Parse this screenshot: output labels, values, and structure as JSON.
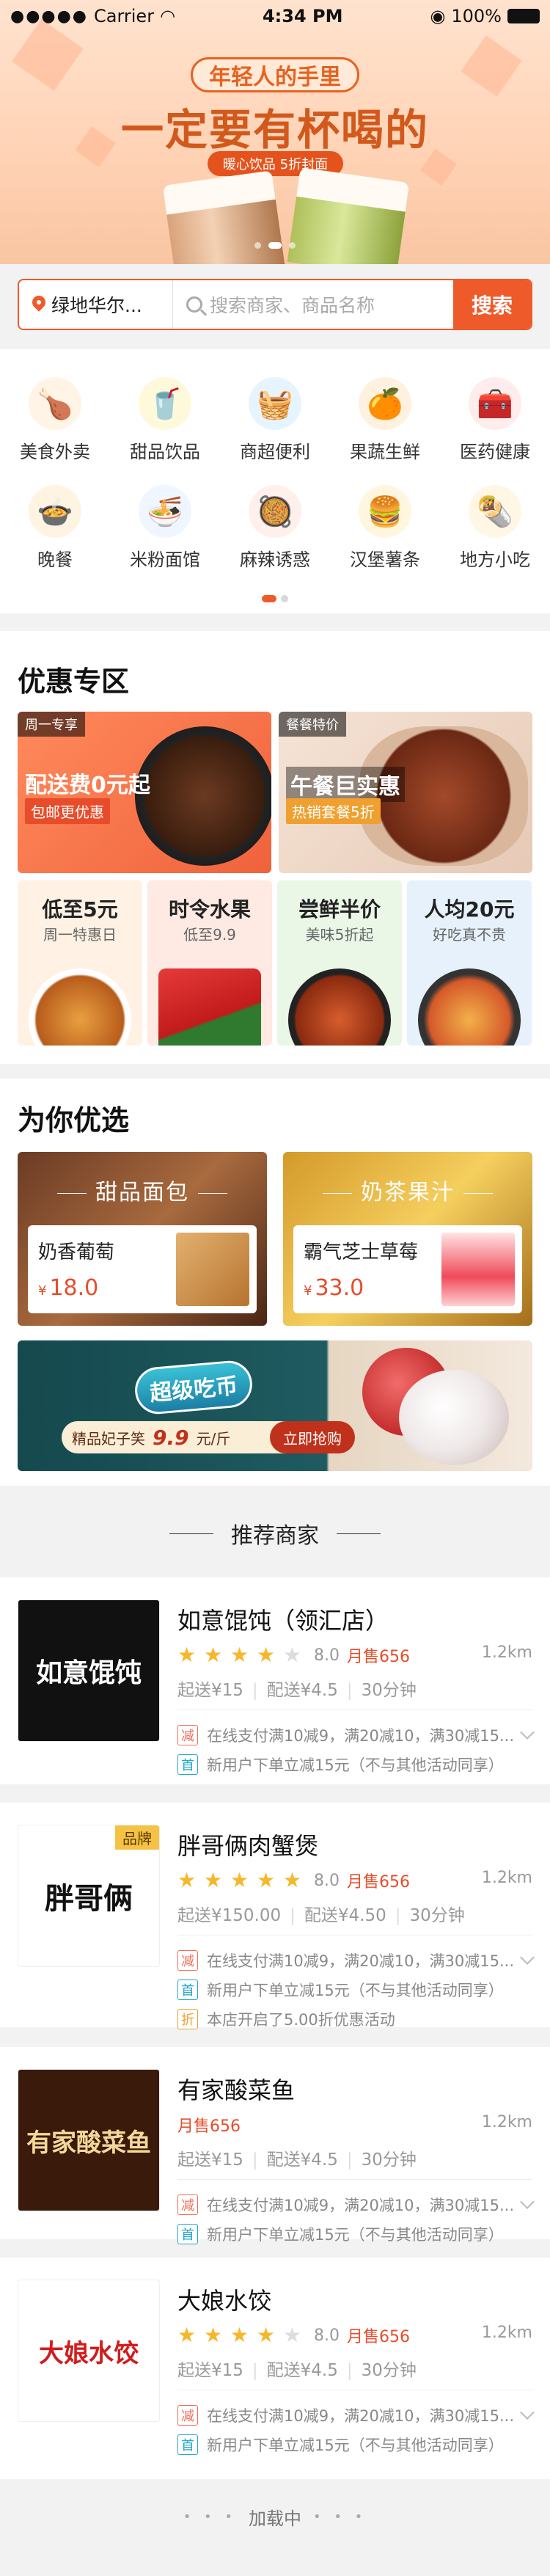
{
  "status_bar": {
    "carrier": "Carrier",
    "time": "4:34 PM",
    "battery": "100%"
  },
  "banner": {
    "line1": "年轻人的手里",
    "line2": "一定要有杯喝的",
    "tag": "暖心饮品 5折封面"
  },
  "search": {
    "location": "绿地华尔...",
    "placeholder": "搜索商家、商品名称",
    "button": "搜索"
  },
  "categories": [
    {
      "label": "美食外卖",
      "icon": "fried-chicken-icon",
      "glyph": "🍗",
      "bg": "#fff4e6"
    },
    {
      "label": "甜品饮品",
      "icon": "drink-cup-icon",
      "glyph": "🥤",
      "bg": "#fff9db"
    },
    {
      "label": "商超便利",
      "icon": "shopping-basket-icon",
      "glyph": "🧺",
      "bg": "#e6f4ff"
    },
    {
      "label": "果蔬生鲜",
      "icon": "orange-fruit-icon",
      "glyph": "🍊",
      "bg": "#fff1e0"
    },
    {
      "label": "医药健康",
      "icon": "medicine-kit-icon",
      "glyph": "🧰",
      "bg": "#ffecec"
    },
    {
      "label": "晚餐",
      "icon": "dinner-bowl-icon",
      "glyph": "🍲",
      "bg": "#fff3e2"
    },
    {
      "label": "米粉面馆",
      "icon": "noodle-bowl-icon",
      "glyph": "🍜",
      "bg": "#f0f6ff"
    },
    {
      "label": "麻辣诱惑",
      "icon": "spicy-bowl-icon",
      "glyph": "🥘",
      "bg": "#fff0ec"
    },
    {
      "label": "汉堡薯条",
      "icon": "burger-icon",
      "glyph": "🍔",
      "bg": "#fff6e0"
    },
    {
      "label": "地方小吃",
      "icon": "local-snack-icon",
      "glyph": "🌯",
      "bg": "#fff6e6"
    }
  ],
  "promo": {
    "title": "优惠专区",
    "big": [
      {
        "tag": "周一专享",
        "headline": "配送费0元起",
        "sub": "包邮更优惠"
      },
      {
        "tag": "餐餐特价",
        "headline": "午餐巨实惠",
        "sub": "热销套餐5折"
      }
    ],
    "small": [
      {
        "headline": "低至5元",
        "sub": "周一特惠日"
      },
      {
        "headline": "时令水果",
        "sub": "低至9.9"
      },
      {
        "headline": "尝鲜半价",
        "sub": "美味5折起"
      },
      {
        "headline": "人均20元",
        "sub": "好吃真不贵"
      }
    ]
  },
  "picks": {
    "title": "为你优选",
    "cards": [
      {
        "category": "甜品面包",
        "name": "奶香葡萄",
        "currency": "¥",
        "price": "18.0"
      },
      {
        "category": "奶茶果汁",
        "name": "霸气芝士草莓",
        "currency": "¥",
        "price": "33.0"
      }
    ],
    "ad": {
      "logo": "超级吃币",
      "text": "精品妃子笑",
      "price": "9.9",
      "unit": "元/斤",
      "cta": "立即抢购"
    }
  },
  "merchants": {
    "heading": "推荐商家",
    "items": [
      {
        "name": "如意馄饨（领汇店）",
        "logo_text": "如意馄饨",
        "brand_badge": "",
        "stars": 4,
        "score": "8.0",
        "sold": "月售656",
        "distance": "1.2km",
        "min_order": "起送¥15",
        "delivery_fee": "配送¥4.5",
        "time": "30分钟",
        "activities": [
          {
            "badge": "减",
            "text": "在线支付满10减9，满20减10，满30减15..."
          },
          {
            "badge": "首",
            "text": "新用户下单立减15元（不与其他活动同享）"
          }
        ]
      },
      {
        "name": "胖哥俩肉蟹煲",
        "logo_text": "胖哥俩",
        "brand_badge": "品牌",
        "stars": 5,
        "score": "8.0",
        "sold": "月售656",
        "distance": "1.2km",
        "min_order": "起送¥150.00",
        "delivery_fee": "配送¥4.50",
        "time": "30分钟",
        "activities": [
          {
            "badge": "减",
            "text": "在线支付满10减9，满20减10，满30减15..."
          },
          {
            "badge": "首",
            "text": "新用户下单立减15元（不与其他活动同享）"
          },
          {
            "badge": "折",
            "text": "本店开启了5.00折优惠活动"
          }
        ]
      },
      {
        "name": "有家酸菜鱼",
        "logo_text": "有家酸菜鱼",
        "brand_badge": "",
        "stars": 0,
        "score": "",
        "sold": "月售656",
        "distance": "1.2km",
        "min_order": "起送¥15",
        "delivery_fee": "配送¥4.5",
        "time": "30分钟",
        "activities": [
          {
            "badge": "减",
            "text": "在线支付满10减9，满20减10，满30减15..."
          },
          {
            "badge": "首",
            "text": "新用户下单立减15元（不与其他活动同享）"
          }
        ]
      },
      {
        "name": "大娘水饺",
        "logo_text": "大娘水饺",
        "brand_badge": "",
        "stars": 4,
        "score": "8.0",
        "sold": "月售656",
        "distance": "1.2km",
        "min_order": "起送¥15",
        "delivery_fee": "配送¥4.5",
        "time": "30分钟",
        "activities": [
          {
            "badge": "减",
            "text": "在线支付满10减9，满20减10，满30减15..."
          },
          {
            "badge": "首",
            "text": "新用户下单立减15元（不与其他活动同享）"
          }
        ]
      }
    ]
  },
  "footer": {
    "loading": "加载中"
  },
  "colors": {
    "accent": "#ef5a2a",
    "star": "#f6b72a",
    "price": "#e84c2a"
  }
}
